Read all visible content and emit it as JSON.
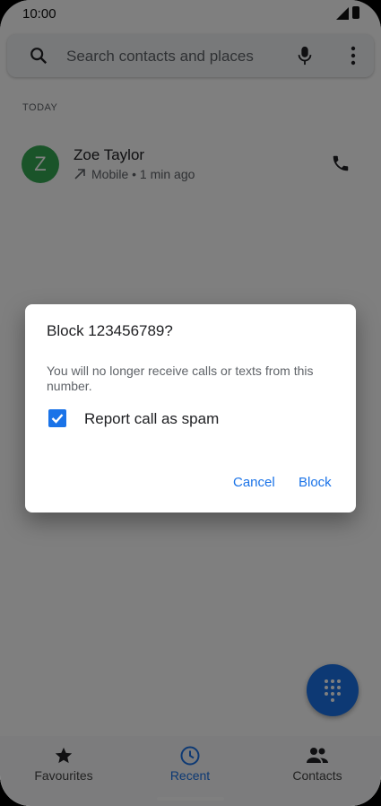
{
  "status_bar": {
    "time": "10:00"
  },
  "search": {
    "placeholder": "Search contacts and places"
  },
  "section": {
    "title": "TODAY"
  },
  "call_log": [
    {
      "initial": "Z",
      "name": "Zoe Taylor",
      "details": "Mobile • 1 min ago"
    }
  ],
  "dialog": {
    "title": "Block 123456789?",
    "message": "You will no longer receive calls or texts from this number.",
    "checkbox_label": "Report call as spam",
    "checkbox_checked": true,
    "cancel_label": "Cancel",
    "block_label": "Block"
  },
  "bottom_nav": {
    "items": [
      {
        "label": "Favourites",
        "icon": "star-icon"
      },
      {
        "label": "Recent",
        "icon": "clock-icon",
        "active": true
      },
      {
        "label": "Contacts",
        "icon": "people-icon"
      }
    ]
  },
  "colors": {
    "accent": "#1a73e8",
    "avatar": "#34a853"
  }
}
